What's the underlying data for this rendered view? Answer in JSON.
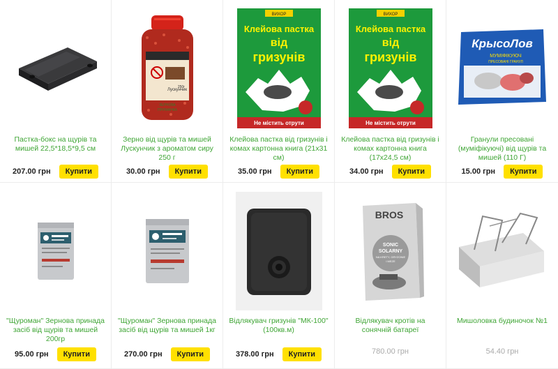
{
  "currency": "грн",
  "buy_label": "Купити",
  "products": [
    {
      "title": "Пастка-бокс на щурів та мишей 22,5*18,5*9,5 см",
      "price": "207.00 грн",
      "available": true,
      "image": "black-bait-box"
    },
    {
      "title": "Зерно від щурів та мишей Лускунчик з ароматом сиру 250 г",
      "price": "30.00 грн",
      "available": true,
      "image": "red-grain-jar",
      "image_text": {
        "brand": "Лускунчик",
        "line1": "ЗЕРНОВА",
        "line2": "ПРИМАНКА",
        "weight": "250г"
      }
    },
    {
      "title": "Клейова пастка від гризунів і комах картонна книга (21x31 см)",
      "price": "35.00 грн",
      "available": true,
      "image": "glue-trap-pack",
      "image_text": {
        "brand": "ВИХОР",
        "headline_1": "Клейова пастка",
        "headline_2": "від",
        "headline_3": "гризунів",
        "footer": "Не містить отрути"
      }
    },
    {
      "title": "Клейова пастка від гризунів і комах картонна книга (17х24,5 см)",
      "price": "34.00 грн",
      "available": true,
      "image": "glue-trap-pack",
      "image_text": {
        "brand": "ВИХОР",
        "headline_1": "Клейова пастка",
        "headline_2": "від",
        "headline_3": "гризунів",
        "footer": "Не містить отрути"
      }
    },
    {
      "title": "Гранули пресовані (муміфікуючі) від щурів та мишей (110 Г)",
      "price": "15.00 грн",
      "available": true,
      "image": "krysolov-pack",
      "image_text": {
        "brand": "КрысоЛов",
        "sub": "МУМІФІКУЮЧ",
        "sub2": "ПРЕСОВАНІ ГРАНУЛ"
      }
    },
    {
      "title": "\"Щуроман\" Зернова принада засіб від щурів та мишей 200гр",
      "price": "95.00 грн",
      "available": true,
      "image": "grey-pouch-small"
    },
    {
      "title": "\"Щуроман\" Зернова принада засіб від щурів та мишей 1кг",
      "price": "270.00 грн",
      "available": true,
      "image": "grey-pouch-large"
    },
    {
      "title": "Відлякувач гризунів \"МК-100\" (100кв.м)",
      "price": "378.00 грн",
      "available": true,
      "image": "black-repeller"
    },
    {
      "title": "Відлякувач кротів на сонячній батареї",
      "price": "780.00 грн",
      "available": false,
      "image": "bros-box",
      "image_text": {
        "brand": "BROS",
        "l1": "SONIC",
        "l2": "SOLARNY",
        "l3": "NA KRETY, GRYZONIE",
        "l4": "I MEZE"
      }
    },
    {
      "title": "Мишоловка будиночок №1",
      "price": "54.40 грн",
      "available": false,
      "image": "house-trap"
    }
  ]
}
